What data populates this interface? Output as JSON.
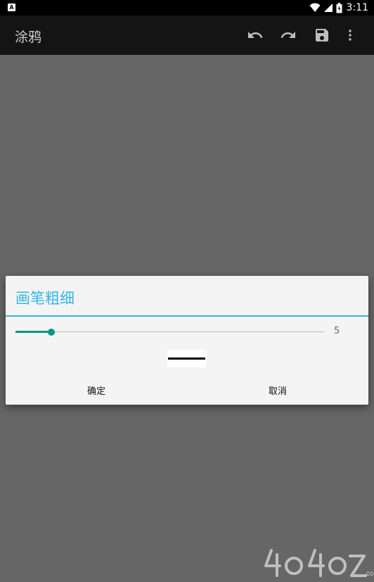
{
  "status_bar": {
    "notification_label": "A",
    "time": "3:11"
  },
  "app_bar": {
    "title": "涂鸦",
    "actions": [
      {
        "name": "undo",
        "icon": "undo-icon"
      },
      {
        "name": "redo",
        "icon": "redo-icon"
      },
      {
        "name": "save",
        "icon": "save-icon"
      },
      {
        "name": "more",
        "icon": "more-vert-icon"
      }
    ]
  },
  "dialog": {
    "title": "画笔粗细",
    "slider": {
      "value": 5,
      "min": 0,
      "max": 100,
      "value_label": "5"
    },
    "confirm_label": "确定",
    "cancel_label": "取消"
  },
  "colors": {
    "accent": "#33b5e5",
    "slider": "#009688",
    "backdrop": "#666666",
    "toolbar": "#141414"
  }
}
